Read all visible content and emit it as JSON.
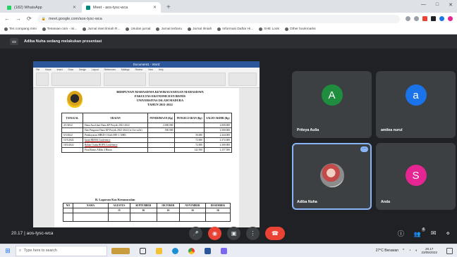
{
  "browser": {
    "tabs": [
      {
        "label": "(182) WhatsApp",
        "fav_color": "#25d366",
        "active": false
      },
      {
        "label": "Meet - aos-tysc-wca",
        "fav_color": "#00897b",
        "active": true
      }
    ],
    "new_tab_glyph": "+",
    "window_controls": [
      "—",
      "□",
      "✕"
    ],
    "url": "meet.google.com/aos-tysc-wca",
    "bookmarks": [
      "Tes compang mini",
      "Tesaniae.com - ini...",
      "Jurnal riset ilmiah R...",
      "Usulan jurnal",
      "Jurnal terbaru",
      "Jurnal Ilmiah",
      "Informasi Daftar Hi...",
      "SHE Look",
      "Other bookmarks"
    ]
  },
  "meet": {
    "presenting_text": "Adiba Nuha sedang melakukan presentasi",
    "meeting_time": "20.17",
    "meeting_code": "aos-tysc-wca",
    "participants": [
      {
        "name": "Priteya Aulia",
        "initial": "A",
        "color": "#1e8e3e",
        "photo": false,
        "highlight": false
      },
      {
        "name": "amilea nurul",
        "initial": "a",
        "color": "#1a73e8",
        "photo": false,
        "highlight": false
      },
      {
        "name": "Adiba Nuha",
        "initial": "",
        "color": "#3c4043",
        "photo": true,
        "highlight": true
      },
      {
        "name": "Anda",
        "initial": "S",
        "color": "#e52592",
        "photo": false,
        "highlight": false
      }
    ],
    "participant_count": "4",
    "tile_menu_glyph": "…"
  },
  "document": {
    "window_title": "Document1 - Word",
    "ribbon_tabs": [
      "File",
      "Home",
      "Insert",
      "Draw",
      "Design",
      "Layout",
      "References",
      "Mailings",
      "Review",
      "View",
      "Help"
    ],
    "header_lines": [
      "BIDIPUNAN MAHASISWA KEWIRAUSAHAAN MAHASISWA",
      "FAKULTAS EKONOMI DAN BISNIS",
      "UNIVERSITAS ISLAM MADURA",
      "TAHUN 2021-2022"
    ],
    "table_headers": [
      "TANGGAL",
      "URAIAN",
      "PENERIMAAN (Rp)",
      "PENGELUARAN (Rp)",
      "SALDO AKHIR (Rp)"
    ],
    "rows": [
      {
        "date": "4/1/2022",
        "desc": "Dana Awal dari Dana KP Proyek 2021-2022",
        "in": "2.000.000",
        "out": "",
        "saldo": "2.000.000"
      },
      {
        "date": "",
        "desc": "Dan Pengurus Dana KP Proyek 2021-2022 (sr1 ke sr2fs)",
        "in": "500.000",
        "out": "",
        "saldo": "2.500.000"
      },
      {
        "date": "6/5/2022",
        "desc": "Pembayaran SHKD-1 Kidi (SPJ-1 1080)",
        "in": "",
        "out": "56.000",
        "saldo": "2.444.000"
      },
      {
        "date": "11/5/2022",
        "desc": "Iuran BKMA Conference",
        "in": "",
        "out": "72.000",
        "saldo": "2.372.000"
      },
      {
        "date": "18/5/2022",
        "desc": "Beban Usaha BOPA Conference",
        "in": "",
        "out": "72.000",
        "saldo": "2.300.000"
      },
      {
        "date": "",
        "desc": "Fixa Bonus Alkhu 4 Hinan",
        "in": "",
        "out": "142.500",
        "saldo": "2.157.500"
      }
    ],
    "section2_title": "B.   Laporan Kas Kemunculan",
    "table2_headers": [
      "NO",
      "NAMA",
      "AGUSTUS",
      "SEPTEMBER",
      "OKTOBER",
      "NOVEMBER",
      "DESEMBER"
    ],
    "table2_sub": [
      "",
      "",
      "15",
      "16",
      "16",
      "16",
      "16"
    ]
  },
  "taskbar": {
    "search_placeholder": "Type here to search",
    "weather": "27°C Berawan",
    "time": "20.17",
    "date": "23/05/2022"
  },
  "icons": {
    "back": "←",
    "forward": "→",
    "reload": "⟳",
    "lock": "🔒",
    "mic": "🎤",
    "cam": "◉",
    "present": "▣",
    "more": "⋮",
    "end": "☎",
    "info": "ⓘ",
    "people": "👥",
    "chat": "✉",
    "activities": "⋄",
    "windows": "⊞",
    "search": "⌕"
  }
}
